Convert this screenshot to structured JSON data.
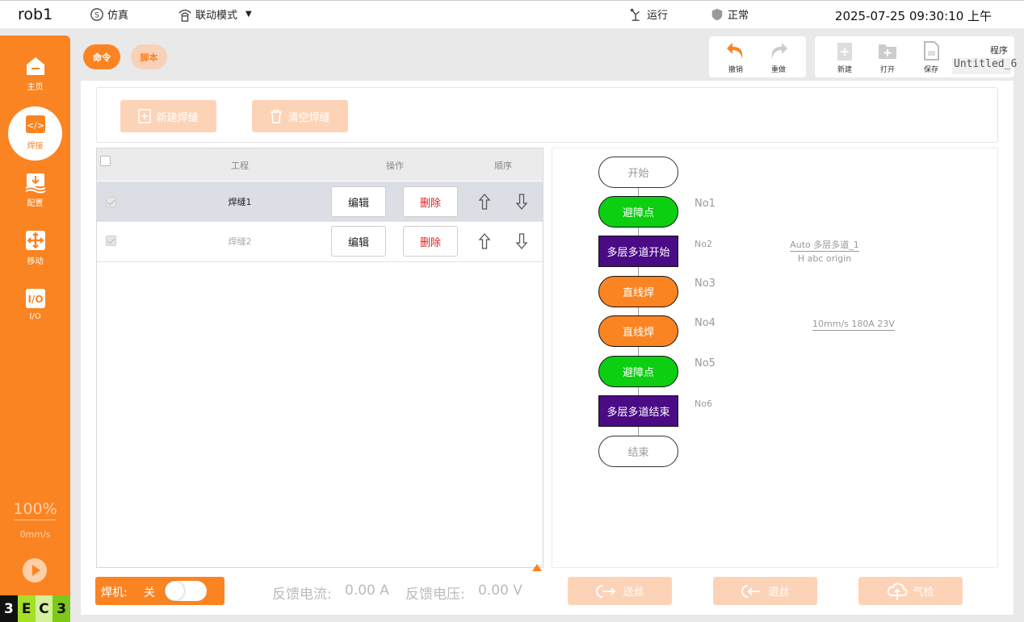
{
  "topbar": {
    "robot_name": "rob1",
    "sim_label": "仿真",
    "mode_label": "联动模式",
    "run_label": "运行",
    "status_label": "正常",
    "datetime": "2025-07-25 09:30:10 上午"
  },
  "sidebar": {
    "items": [
      {
        "label": "主页",
        "icon": "home-icon"
      },
      {
        "label": "焊接",
        "icon": "code-icon"
      },
      {
        "label": "配置",
        "icon": "config-icon"
      },
      {
        "label": "移动",
        "icon": "move-icon"
      },
      {
        "label": "I/O",
        "icon": "io-icon"
      }
    ],
    "speed_percent": "100%",
    "speed_mms": "0mm/s",
    "badge": [
      "3",
      "E",
      "C",
      "3"
    ]
  },
  "header": {
    "tab_command": "命令",
    "tab_script": "脚本",
    "undo_label": "撤销",
    "redo_label": "重做",
    "new_label": "新建",
    "open_label": "打开",
    "save_label": "保存",
    "program_label": "程序",
    "program_name": "Untitled_6"
  },
  "actions": {
    "new_seam": "新建焊缝",
    "clear_seam": "清空焊缝"
  },
  "table": {
    "col_project": "工程",
    "col_ops": "操作",
    "col_order": "顺序",
    "edit_label": "编辑",
    "delete_label": "删除",
    "rows": [
      {
        "name": "焊缝1"
      },
      {
        "name": "焊缝2"
      }
    ]
  },
  "flow": {
    "start": "开始",
    "end": "结束",
    "nodes": [
      {
        "label": "避障点",
        "no": "No1"
      },
      {
        "label": "多层多道开始",
        "no": "No2",
        "param1": "Auto 多层多道_1",
        "param2": "H abc origin"
      },
      {
        "label": "直线焊",
        "no": "No3"
      },
      {
        "label": "直线焊",
        "no": "No4",
        "param1": "10mm/s 180A 23V"
      },
      {
        "label": "避障点",
        "no": "No5"
      },
      {
        "label": "多层多道结束",
        "no": "No6"
      }
    ]
  },
  "bottom": {
    "welder_label": "焊机:",
    "welder_state": "关",
    "current_label": "反馈电流:",
    "current_value": "0.00 A",
    "voltage_label": "反馈电压:",
    "voltage_value": "0.00 V",
    "feed_label": "送丝",
    "retract_label": "退丝",
    "gas_label": "气检"
  },
  "colors": {
    "accent": "#fb8422",
    "green": "#0ccf12",
    "purple": "#4a0b85"
  }
}
